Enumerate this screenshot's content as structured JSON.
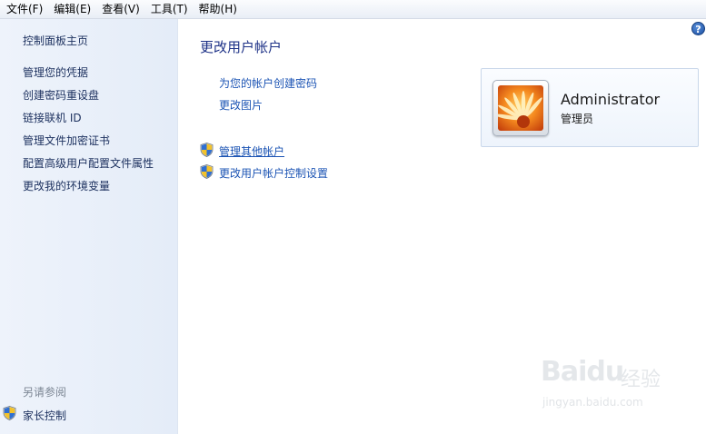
{
  "menubar": {
    "items": [
      "文件(F)",
      "编辑(E)",
      "查看(V)",
      "工具(T)",
      "帮助(H)"
    ]
  },
  "sidebar": {
    "home": "控制面板主页",
    "links": [
      "管理您的凭据",
      "创建密码重设盘",
      "链接联机 ID",
      "管理文件加密证书",
      "配置高级用户配置文件属性",
      "更改我的环境变量"
    ],
    "see_also_heading": "另请参阅",
    "see_also_links": [
      "家长控制"
    ]
  },
  "main": {
    "title": "更改用户帐户",
    "tasks": [
      "为您的帐户创建密码",
      "更改图片"
    ],
    "admin_tasks": [
      "管理其他帐户",
      "更改用户帐户控制设置"
    ]
  },
  "account": {
    "name": "Administrator",
    "role": "管理员"
  },
  "help": {
    "glyph": "?"
  },
  "watermark": {
    "logo": "Baidu",
    "cn": "经验",
    "url": "jingyan.baidu.com"
  },
  "colors": {
    "link": "#1c54b4",
    "title": "#1e3287",
    "sidebar_bg": "#e8eef9"
  }
}
